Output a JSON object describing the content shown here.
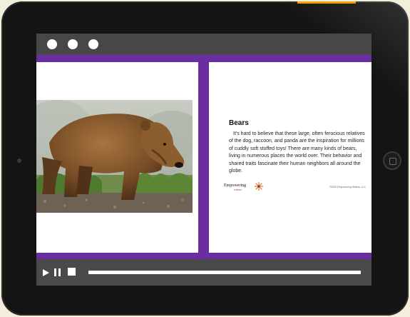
{
  "viewer": {
    "window_controls": [
      "window-dot",
      "window-dot",
      "window-dot"
    ],
    "colors": {
      "accent_purple": "#6a2ea0",
      "frame": "#141414",
      "bar": "#474747"
    }
  },
  "page_right": {
    "heading": "Bears",
    "body": "It's hard to believe that these large, often ferocious relatives of the dog, raccoon, and panda are the inspiration for millions of cuddly soft stuffed toys! There are many kinds of bears, living in numerous places the world over. Their behavior and shared traits fascinate their human neighbors all around the globe.",
    "brand_name": "Empowering",
    "brand_sub": "writers",
    "copyright": "©2020 Empowering Writers, LLC"
  },
  "page_left": {
    "image": "brown-bear-photo"
  },
  "controls": {
    "play_icon": "play-icon",
    "pause_icon": "pause-icon",
    "stop_icon": "stop-icon",
    "progress": 0
  }
}
